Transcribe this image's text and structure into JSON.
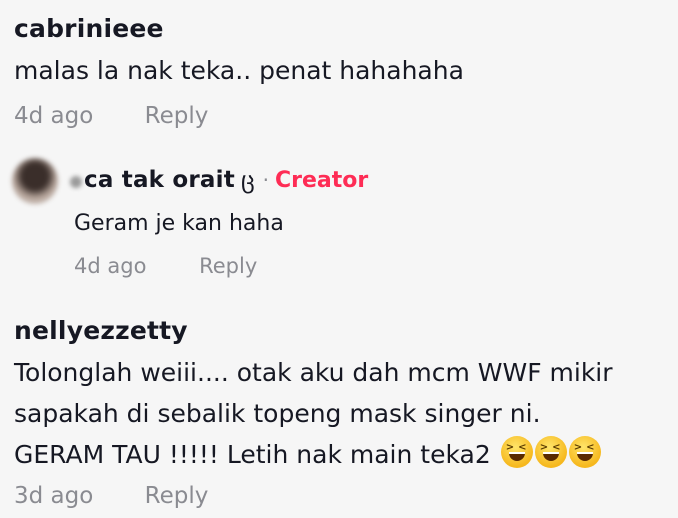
{
  "comments": [
    {
      "username": "cabrinieee",
      "text": "malas la nak teka.. penat hahahaha",
      "time": "4d ago",
      "reply_label": "Reply"
    },
    {
      "username": "nellyezzetty",
      "lines": [
        "Tolonglah weiii.... otak aku dah mcm WWF mikir",
        "sapakah di sebalik topeng mask singer ni.",
        "GERAM TAU !!!!! Letih nak main teka2"
      ],
      "emojis": [
        "laughing-emoji",
        "laughing-emoji",
        "laughing-emoji"
      ],
      "time": "3d ago",
      "reply_label": "Reply"
    }
  ],
  "reply": {
    "username": "ca tak orait",
    "flourish": "ც",
    "separator": "·",
    "badge": "Creator",
    "text": "Geram je kan haha",
    "time": "4d ago",
    "reply_label": "Reply"
  },
  "colors": {
    "background": "#f6f6f6",
    "text": "#161823",
    "muted": "#8a8b91",
    "creator_badge": "#fe2c55"
  }
}
